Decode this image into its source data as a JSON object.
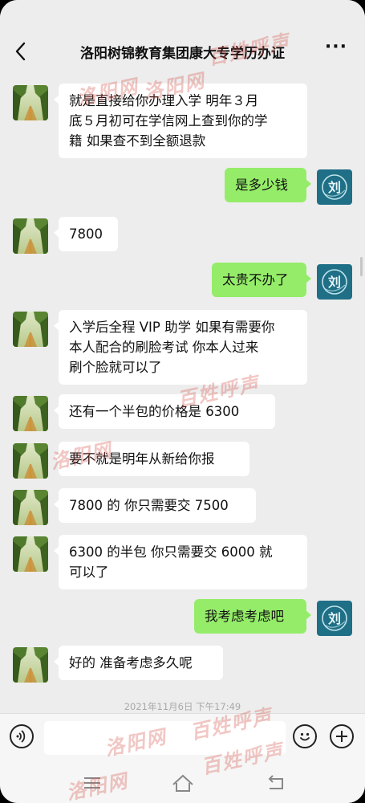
{
  "header": {
    "title": "洛阳树锦教育集团康大专学历办证",
    "more_label": "···"
  },
  "messages": [
    {
      "side": "left",
      "lines": [
        "就是直接给你办理入学  明年３月",
        "底５月初可在学信网上查到你的学",
        "籍 如果查不到全额退款"
      ]
    },
    {
      "side": "right",
      "lines": [
        "是多少钱"
      ]
    },
    {
      "side": "left",
      "lines": [
        "7800"
      ]
    },
    {
      "side": "right",
      "lines": [
        "太贵不办了"
      ]
    },
    {
      "side": "left",
      "lines": [
        "入学后全程 VIP 助学 如果有需要你",
        "本人配合的刷脸考试  你本人过来",
        "刷个脸就可以了"
      ]
    },
    {
      "side": "left",
      "lines": [
        "还有一个半包的价格是 6300"
      ]
    },
    {
      "side": "left",
      "lines": [
        "要不就是明年从新给你报"
      ]
    },
    {
      "side": "left",
      "lines": [
        "7800 的 你只需要交 7500"
      ]
    },
    {
      "side": "left",
      "lines": [
        "6300 的半包 你只需要交 6000 就",
        "可以了"
      ]
    },
    {
      "side": "right",
      "lines": [
        "我考虑考虑吧"
      ]
    },
    {
      "side": "left",
      "lines": [
        "好的 准备考虑多久呢"
      ]
    }
  ],
  "timestamp": "2021年11月6日 下午17:49",
  "self_avatar_text": "刘",
  "watermarks": [
    "洛阳网",
    "洛阳网",
    "百姓呼声",
    "洛阳网",
    "百姓呼声",
    "洛阳网",
    "百姓呼声",
    "洛阳网",
    "百姓呼声"
  ],
  "colors": {
    "chat_bg": "#ededed",
    "self_bubble": "#95ec69",
    "other_bubble": "#ffffff",
    "self_avatar": "#1f6f86"
  }
}
